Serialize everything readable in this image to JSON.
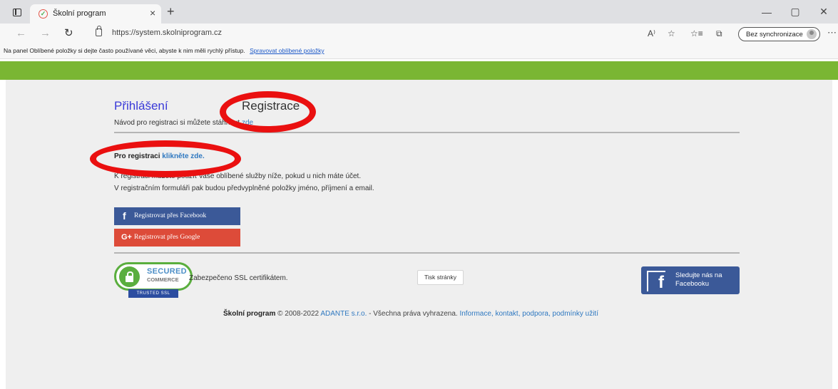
{
  "browser": {
    "tab_title": "Školní program",
    "tab_close": "×",
    "new_tab": "+",
    "url": "https://system.skolniprogram.cz",
    "sync_label": "Bez synchronizace",
    "win_min": "—",
    "win_restore": "▢",
    "win_close": "✕"
  },
  "favorites_bar": {
    "text": "Na panel Oblíbené položky si dejte často používané věci, abyste k nim měli rychlý přístup.",
    "link": "Spravovat oblíbené položky"
  },
  "page": {
    "tabs": {
      "login": "Přihlášení",
      "register": "Registrace"
    },
    "guide": {
      "text": "Návod pro registraci si můžete stáhnout",
      "link": "zde"
    },
    "register_cta": {
      "text": "Pro registraci",
      "link": "klikněte zde."
    },
    "info_lines": [
      "K registraci můžete použít Vaše oblíbené služby níže, pokud u nich máte účet.",
      "V registračním formuláři pak budou předvyplněné položky jméno, příjmení a email."
    ],
    "facebook_button": "Registrovat přes Facebook",
    "google_button": "Registrovat přes Google",
    "ssl": {
      "secured": "SECURED",
      "commerce": "COMMERCE",
      "trusted": "TRUSTED SSL",
      "text": "Zabezpečeno SSL certifikátem."
    },
    "print_button": "Tisk stránky",
    "facebook_follow": "Sledujte nás na Facebooku",
    "footer": {
      "brand": "Školní program",
      "copyright": "© 2008-2022",
      "company": "ADANTE s.r.o.",
      "rights": "- Všechna práva vyhrazena.",
      "links": "Informace, kontakt, podpora, podmínky užití"
    }
  },
  "colors": {
    "brand_green": "#7ab633",
    "facebook_blue": "#3b5998",
    "google_red": "#dd4b39",
    "link_blue": "#2f78c0",
    "annotation_red": "#ea1010"
  }
}
